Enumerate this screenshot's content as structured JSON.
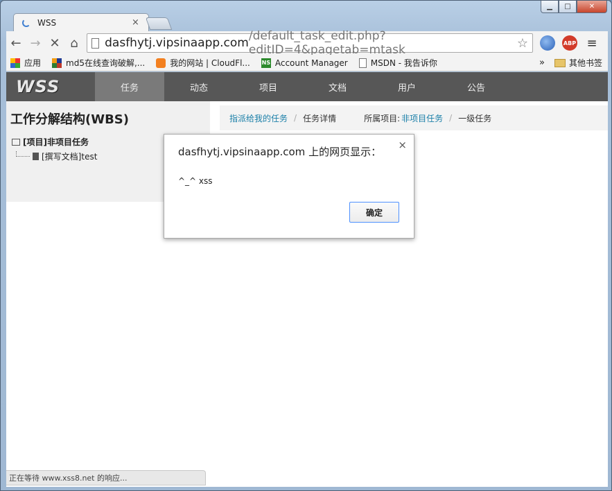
{
  "browser": {
    "tab_title": "WSS",
    "url_host": "dasfhytj.vipsinaapp.com",
    "url_path": "/default_task_edit.php?editID=4&pagetab=mtask",
    "abp_label": "ABP"
  },
  "bookmarks": {
    "items": [
      {
        "label": "应用"
      },
      {
        "label": "md5在线查询破解,..."
      },
      {
        "label": "我的网站 | CloudFl..."
      },
      {
        "label": "Account Manager"
      },
      {
        "label": "MSDN - 我告诉你"
      }
    ],
    "more": "»",
    "other_folder": "其他书签"
  },
  "site": {
    "logo": "WSS",
    "nav": [
      {
        "label": "任务",
        "active": true
      },
      {
        "label": "动态"
      },
      {
        "label": "项目"
      },
      {
        "label": "文档"
      },
      {
        "label": "用户"
      },
      {
        "label": "公告"
      }
    ]
  },
  "sidebar": {
    "title": "工作分解结构(WBS)",
    "root": "[项目]非项目任务",
    "child": "[撰写文档]test"
  },
  "breadcrumb": {
    "assigned": "指派给我的任务",
    "detail": "任务详情",
    "project_label": "所属项目:",
    "project_link": "非项目任务",
    "level": "一级任务"
  },
  "dialog": {
    "title": "dasfhytj.vipsinaapp.com 上的网页显示：",
    "message": "^_^ xss",
    "ok": "确定",
    "close": "×"
  },
  "status": "正在等待 www.xss8.net 的响应..."
}
